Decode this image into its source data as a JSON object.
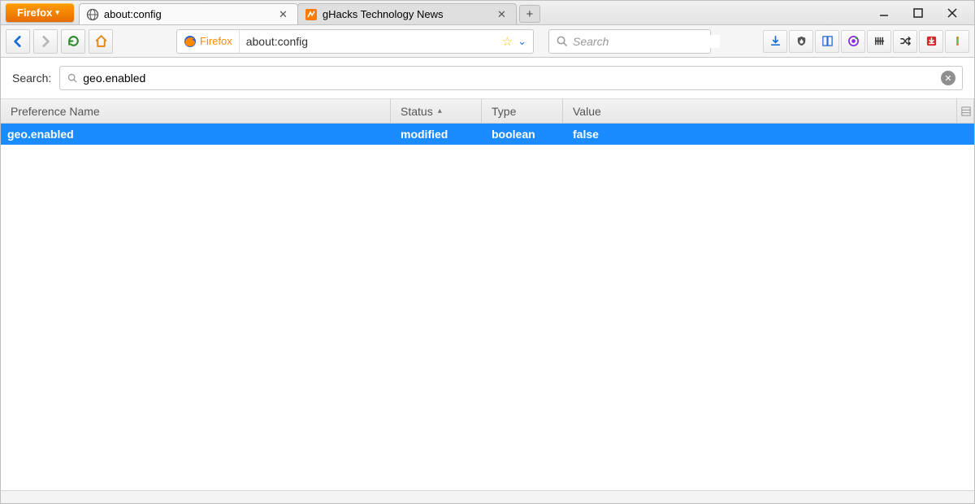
{
  "app_menu_label": "Firefox",
  "tabs": [
    {
      "title": "about:config",
      "active": true,
      "icon": "globe"
    },
    {
      "title": "gHacks Technology News",
      "active": false,
      "icon": "ghacks"
    }
  ],
  "nav": {
    "urlbar_identity_label": "Firefox",
    "urlbar_value": "about:config",
    "search_placeholder": "Search"
  },
  "config": {
    "search_label": "Search:",
    "search_value": "geo.enabled",
    "columns": {
      "name": "Preference Name",
      "status": "Status",
      "type": "Type",
      "value": "Value"
    },
    "sort_column": "status",
    "rows": [
      {
        "name": "geo.enabled",
        "status": "modified",
        "type": "boolean",
        "value": "false",
        "selected": true
      }
    ]
  }
}
